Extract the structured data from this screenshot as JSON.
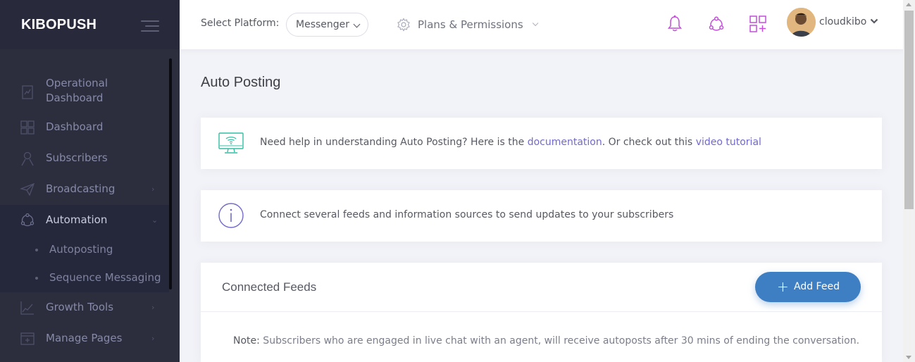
{
  "brand": {
    "name": "KIBOPUSH"
  },
  "sidebar": {
    "items": [
      {
        "label_line1": "Operational",
        "label_line2": "Dashboard"
      },
      {
        "label": "Dashboard"
      },
      {
        "label": "Subscribers"
      },
      {
        "label": "Broadcasting"
      },
      {
        "label": "Automation"
      },
      {
        "label": "Growth Tools"
      },
      {
        "label": "Manage Pages"
      }
    ],
    "subitems": [
      {
        "label": "Autoposting"
      },
      {
        "label": "Sequence Messaging"
      }
    ]
  },
  "header": {
    "platform_label": "Select Platform:",
    "platform_value": "Messenger",
    "plans_label": "Plans & Permissions",
    "username": "cloudkibo"
  },
  "page": {
    "title": "Auto Posting",
    "help": {
      "text_before": "Need help in understanding Auto Posting? Here is the ",
      "doc_link": "documentation",
      "text_middle": ". Or check out this ",
      "video_link": "video tutorial"
    },
    "info_text": "Connect several feeds and information sources to send updates to your subscribers",
    "feeds": {
      "title": "Connected Feeds",
      "add_button": "Add Feed",
      "note_label": "Note:",
      "note_text": " Subscribers who are engaged in live chat with an agent, will receive autoposts after 30 mins of ending the conversation."
    }
  },
  "colors": {
    "sidebar_bg": "#2c2e3e",
    "accent_link": "#716aca",
    "button_primary": "#3e7ec2",
    "header_icon": "#c24fd8"
  }
}
